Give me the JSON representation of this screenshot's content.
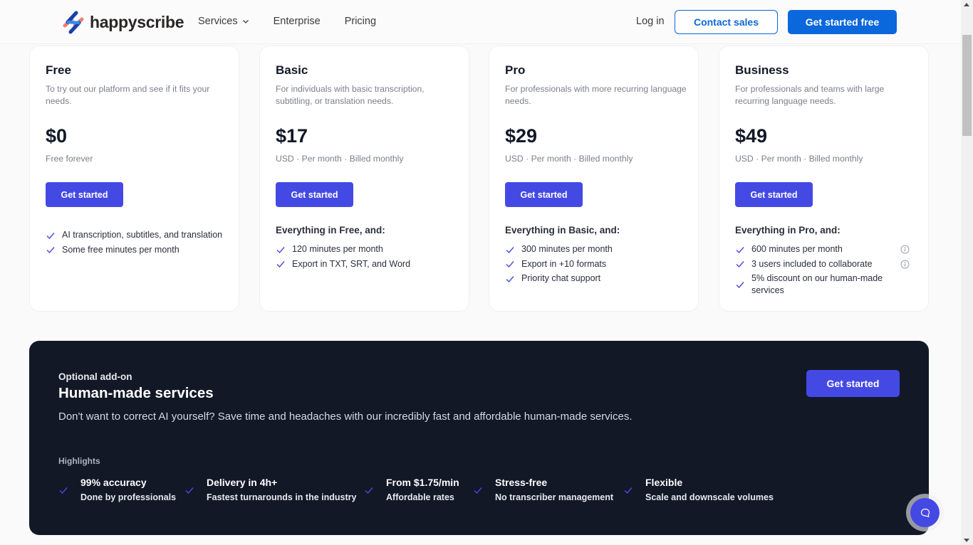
{
  "header": {
    "brand": "happyscribe",
    "nav": [
      {
        "label": "Services",
        "has_dropdown": true
      },
      {
        "label": "Enterprise",
        "has_dropdown": false
      },
      {
        "label": "Pricing",
        "has_dropdown": false
      }
    ],
    "login_label": "Log in",
    "contact_label": "Contact sales",
    "get_started_free_label": "Get started free"
  },
  "plans": [
    {
      "name": "Free",
      "description": "To try out our platform and see if it fits your needs.",
      "price": "$0",
      "billing": "Free forever",
      "cta": "Get started",
      "features_heading": "",
      "features": [
        {
          "text": "AI transcription, subtitles, and translation",
          "info": false
        },
        {
          "text": "Some free minutes per month",
          "info": false
        }
      ]
    },
    {
      "name": "Basic",
      "description": "For individuals with basic transcription, subtitling, or translation needs.",
      "price": "$17",
      "billing": "USD · Per month · Billed monthly",
      "cta": "Get started",
      "features_heading": "Everything in Free, and:",
      "features": [
        {
          "text": "120 minutes per month",
          "info": false
        },
        {
          "text": "Export in TXT, SRT, and Word",
          "info": false
        }
      ]
    },
    {
      "name": "Pro",
      "description": "For professionals with more recurring language needs.",
      "price": "$29",
      "billing": "USD · Per month · Billed monthly",
      "cta": "Get started",
      "features_heading": "Everything in Basic, and:",
      "features": [
        {
          "text": "300 minutes per month",
          "info": false
        },
        {
          "text": "Export in +10 formats",
          "info": false
        },
        {
          "text": "Priority chat support",
          "info": false
        }
      ]
    },
    {
      "name": "Business",
      "description": "For professionals and teams with large recurring language needs.",
      "price": "$49",
      "billing": "USD · Per month · Billed monthly",
      "cta": "Get started",
      "features_heading": "Everything in Pro, and:",
      "features": [
        {
          "text": "600 minutes per month",
          "info": true
        },
        {
          "text": "3 users included to collaborate",
          "info": true
        },
        {
          "text": "5% discount on our human-made services",
          "info": false
        }
      ]
    }
  ],
  "addon": {
    "eyebrow": "Optional add-on",
    "title": "Human-made services",
    "subtitle": "Don't want to correct AI yourself? Save time and headaches with our incredibly fast and affordable human-made services.",
    "cta": "Get started",
    "highlights_label": "Highlights",
    "highlights": [
      {
        "title": "99% accuracy",
        "subtitle": "Done by professionals"
      },
      {
        "title": "Delivery in 4h+",
        "subtitle": "Fastest turnarounds in the industry"
      },
      {
        "title": "From $1.75/min",
        "subtitle": "Affordable rates"
      },
      {
        "title": "Stress-free",
        "subtitle": "No transcriber management"
      },
      {
        "title": "Flexible",
        "subtitle": "Scale and downscale volumes"
      }
    ]
  },
  "colors": {
    "brand_blue": "#0b67dc",
    "accent_indigo": "#4549e4",
    "dark_panel": "#121826"
  }
}
